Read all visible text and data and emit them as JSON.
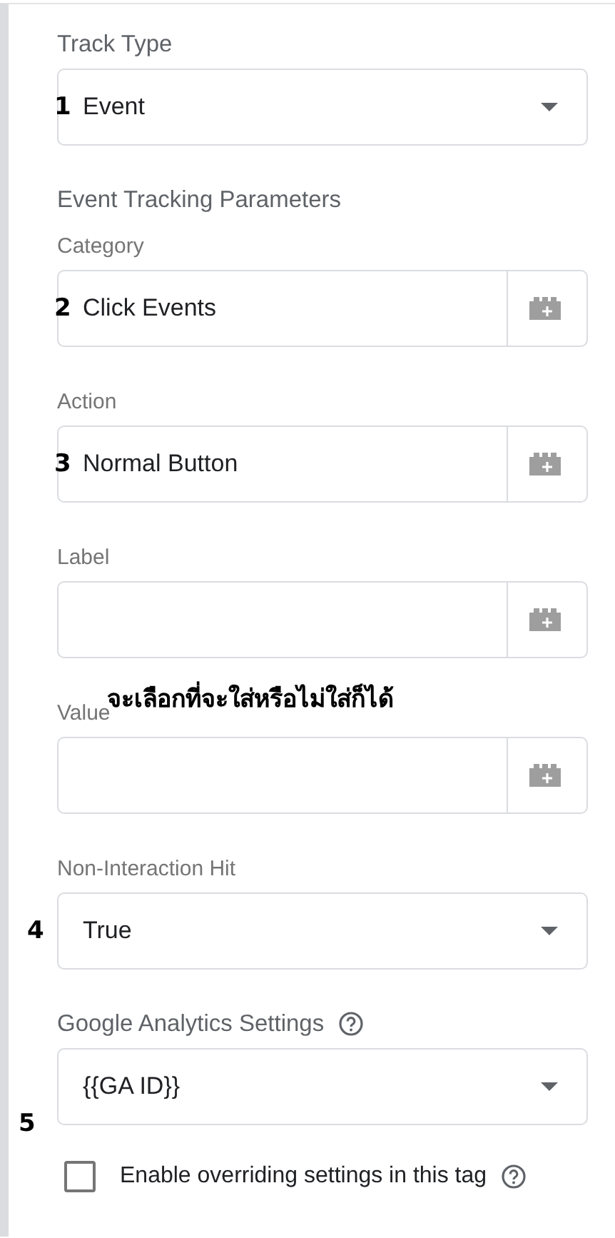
{
  "fields": [
    {
      "kind": "select",
      "label": "Track Type",
      "strong": true,
      "value": "Event",
      "marker": {
        "text": "1",
        "kind": "inside"
      }
    },
    {
      "kind": "heading",
      "label": "Event Tracking Parameters",
      "strong": true
    },
    {
      "kind": "text",
      "label": "Category",
      "strong": false,
      "value": "Click Events",
      "marker": {
        "text": "2",
        "kind": "inside"
      }
    },
    {
      "kind": "text",
      "label": "Action",
      "strong": false,
      "value": "Normal Button",
      "marker": {
        "text": "3",
        "kind": "inside"
      }
    },
    {
      "kind": "text",
      "label": "Label",
      "strong": false
    },
    {
      "kind": "text",
      "label": "Value",
      "strong": false,
      "note": "จะเลือกที่จะใส่หรือไม่ใส่ก็ได้"
    },
    {
      "kind": "select",
      "label": "Non-Interaction Hit",
      "strong": false,
      "value": "True",
      "marker": {
        "text": "4",
        "kind": "outside"
      }
    },
    {
      "kind": "select",
      "label": "Google Analytics Settings",
      "strong": true,
      "help": true,
      "value": "{{GA ID}}",
      "marker": {
        "text": "5",
        "kind": "below"
      }
    },
    {
      "kind": "checkbox",
      "label": "Enable overriding settings in this tag",
      "checked": false,
      "help": true
    }
  ]
}
